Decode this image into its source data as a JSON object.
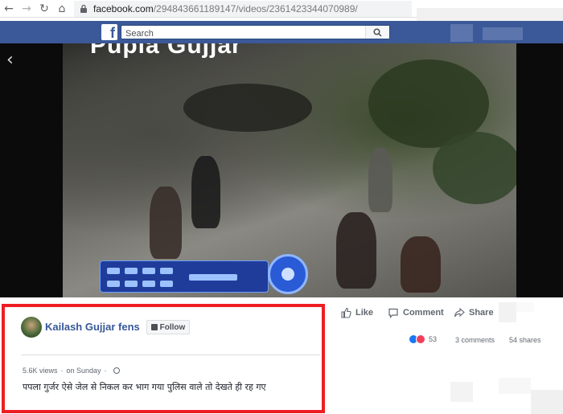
{
  "browser": {
    "url_host": "facebook.com",
    "url_path": "/294843661189147/videos/2361423344070989/"
  },
  "header": {
    "logo": "f",
    "search_placeholder": "Search"
  },
  "video": {
    "title_text": "Pupla Gujjar"
  },
  "post": {
    "author": "Kailash Gujjar fens",
    "follow_label": "Follow",
    "views": "5.6K views",
    "separator": "·",
    "date": "on Sunday",
    "caption": "पपला गुर्जर ऐसे जेल से निकल कर भाग गया पुलिस वाले तो देखते ही रह गए"
  },
  "actions": {
    "like": "Like",
    "comment": "Comment",
    "share": "Share"
  },
  "stats": {
    "reactions_count": "53",
    "comments": "3 comments",
    "shares": "54 shares"
  },
  "colors": {
    "facebook_blue": "#3b5998",
    "link_blue": "#385898",
    "highlight_red": "#ee1d23"
  }
}
